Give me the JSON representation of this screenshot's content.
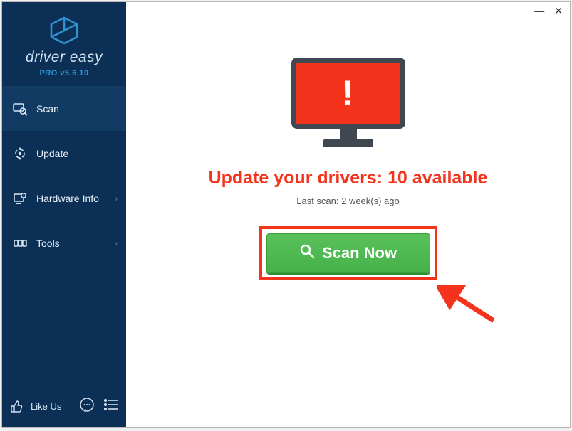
{
  "brand": {
    "name": "driver easy",
    "version": "PRO v5.6.10"
  },
  "sidebar": {
    "items": [
      {
        "label": "Scan",
        "icon": "scan"
      },
      {
        "label": "Update",
        "icon": "update"
      },
      {
        "label": "Hardware Info",
        "icon": "hardware",
        "expandable": true
      },
      {
        "label": "Tools",
        "icon": "tools",
        "expandable": true
      }
    ],
    "active_index": 0
  },
  "bottom": {
    "like_label": "Like Us"
  },
  "main": {
    "headline": "Update your drivers: 10 available",
    "last_scan": "Last scan: 2 week(s) ago",
    "scan_button": "Scan Now"
  },
  "window": {
    "minimize": "—",
    "close": "✕"
  },
  "colors": {
    "accent_red": "#f4331d",
    "sidebar_bg": "#0c2f55",
    "scan_green": "#46b24a"
  }
}
